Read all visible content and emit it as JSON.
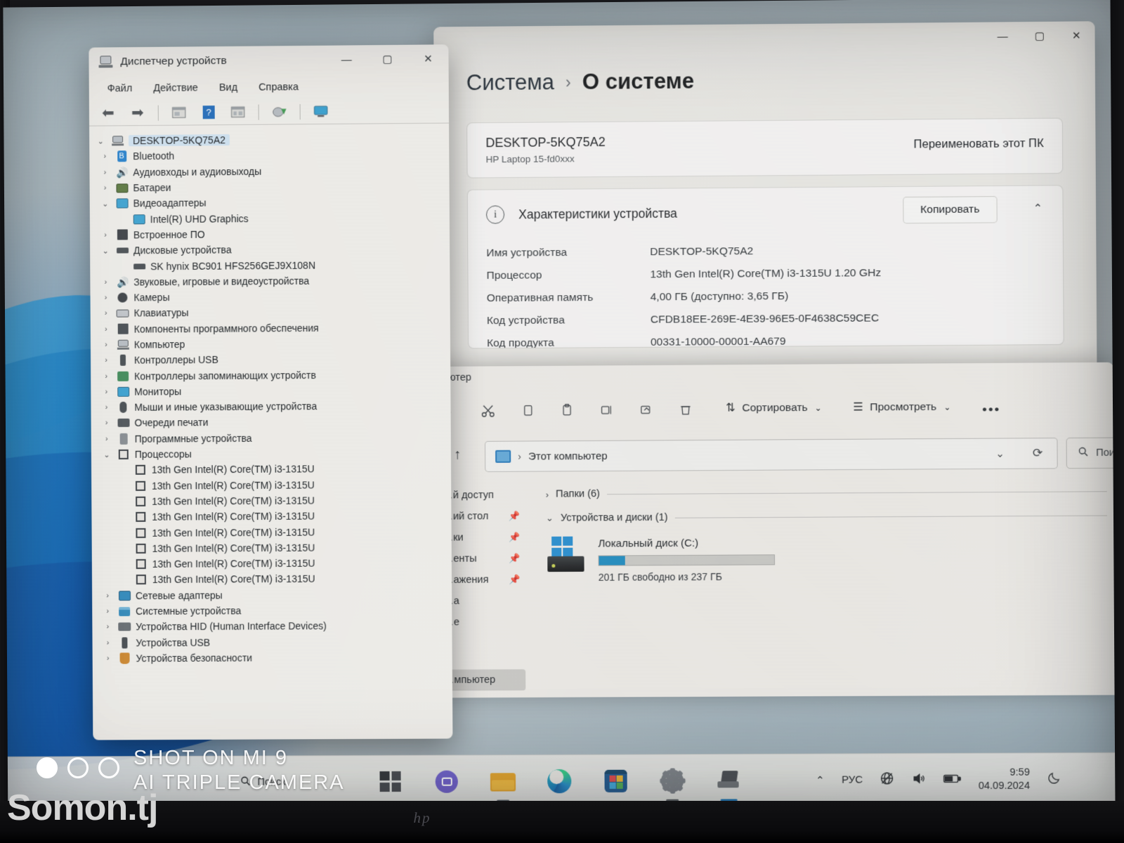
{
  "device_manager": {
    "title": "Диспетчер устройств",
    "window_controls": {
      "minimize": "—",
      "maximize": "▢",
      "close": "✕"
    },
    "menu": [
      "Файл",
      "Действие",
      "Вид",
      "Справка"
    ],
    "root": "DESKTOP-5KQ75A2",
    "tree": [
      {
        "label": "Bluetooth",
        "icon": "bluetooth-icon",
        "level": 1,
        "expanded": false
      },
      {
        "label": "Аудиовходы и аудиовыходы",
        "icon": "speaker-icon",
        "level": 1,
        "expanded": false
      },
      {
        "label": "Батареи",
        "icon": "battery-icon",
        "level": 1,
        "expanded": false
      },
      {
        "label": "Видеоадаптеры",
        "icon": "display-adapter-icon",
        "level": 1,
        "expanded": true
      },
      {
        "label": "Intel(R) UHD Graphics",
        "icon": "display-adapter-icon",
        "level": 2,
        "expanded": null
      },
      {
        "label": "Встроенное ПО",
        "icon": "firmware-icon",
        "level": 1,
        "expanded": false
      },
      {
        "label": "Дисковые устройства",
        "icon": "disk-icon",
        "level": 1,
        "expanded": true
      },
      {
        "label": "SK hynix BC901 HFS256GEJ9X108N",
        "icon": "disk-icon",
        "level": 2,
        "expanded": null
      },
      {
        "label": "Звуковые, игровые и видеоустройства",
        "icon": "speaker-icon",
        "level": 1,
        "expanded": false
      },
      {
        "label": "Камеры",
        "icon": "camera-icon",
        "level": 1,
        "expanded": false
      },
      {
        "label": "Клавиатуры",
        "icon": "keyboard-icon",
        "level": 1,
        "expanded": false
      },
      {
        "label": "Компоненты программного обеспечения",
        "icon": "software-component-icon",
        "level": 1,
        "expanded": false
      },
      {
        "label": "Компьютер",
        "icon": "computer-icon",
        "level": 1,
        "expanded": false
      },
      {
        "label": "Контроллеры USB",
        "icon": "usb-icon",
        "level": 1,
        "expanded": false
      },
      {
        "label": "Контроллеры запоминающих устройств",
        "icon": "storage-controller-icon",
        "level": 1,
        "expanded": false
      },
      {
        "label": "Мониторы",
        "icon": "monitor-icon",
        "level": 1,
        "expanded": false
      },
      {
        "label": "Мыши и иные указывающие устройства",
        "icon": "mouse-icon",
        "level": 1,
        "expanded": false
      },
      {
        "label": "Очереди печати",
        "icon": "printer-icon",
        "level": 1,
        "expanded": false
      },
      {
        "label": "Программные устройства",
        "icon": "software-device-icon",
        "level": 1,
        "expanded": false
      },
      {
        "label": "Процессоры",
        "icon": "cpu-icon",
        "level": 1,
        "expanded": true
      },
      {
        "label": "13th Gen Intel(R) Core(TM) i3-1315U",
        "icon": "cpu-icon",
        "level": 2,
        "expanded": null
      },
      {
        "label": "13th Gen Intel(R) Core(TM) i3-1315U",
        "icon": "cpu-icon",
        "level": 2,
        "expanded": null
      },
      {
        "label": "13th Gen Intel(R) Core(TM) i3-1315U",
        "icon": "cpu-icon",
        "level": 2,
        "expanded": null
      },
      {
        "label": "13th Gen Intel(R) Core(TM) i3-1315U",
        "icon": "cpu-icon",
        "level": 2,
        "expanded": null
      },
      {
        "label": "13th Gen Intel(R) Core(TM) i3-1315U",
        "icon": "cpu-icon",
        "level": 2,
        "expanded": null
      },
      {
        "label": "13th Gen Intel(R) Core(TM) i3-1315U",
        "icon": "cpu-icon",
        "level": 2,
        "expanded": null
      },
      {
        "label": "13th Gen Intel(R) Core(TM) i3-1315U",
        "icon": "cpu-icon",
        "level": 2,
        "expanded": null
      },
      {
        "label": "13th Gen Intel(R) Core(TM) i3-1315U",
        "icon": "cpu-icon",
        "level": 2,
        "expanded": null
      },
      {
        "label": "Сетевые адаптеры",
        "icon": "network-icon",
        "level": 1,
        "expanded": false
      },
      {
        "label": "Системные устройства",
        "icon": "system-device-icon",
        "level": 1,
        "expanded": false
      },
      {
        "label": "Устройства HID (Human Interface Devices)",
        "icon": "hid-icon",
        "level": 1,
        "expanded": false
      },
      {
        "label": "Устройства USB",
        "icon": "usb-icon",
        "level": 1,
        "expanded": false
      },
      {
        "label": "Устройства безопасности",
        "icon": "security-icon",
        "level": 1,
        "expanded": false
      }
    ]
  },
  "settings": {
    "window_controls": {
      "minimize": "—",
      "maximize": "▢",
      "close": "✕"
    },
    "breadcrumb_parent": "Система",
    "breadcrumb_separator": "›",
    "breadcrumb_current": "О системе",
    "pc_name": "DESKTOP-5KQ75A2",
    "pc_model": "HP Laptop 15-fd0xxx",
    "rename_button": "Переименовать этот ПК",
    "specs_title": "Характеристики устройства",
    "copy_button": "Копировать",
    "collapse_chevron": "⌃",
    "info_glyph": "i",
    "specs": [
      {
        "key": "Имя устройства",
        "value": "DESKTOP-5KQ75A2"
      },
      {
        "key": "Процессор",
        "value": "13th Gen Intel(R) Core(TM) i3-1315U   1.20 GHz"
      },
      {
        "key": "Оперативная память",
        "value": "4,00 ГБ (доступно: 3,65 ГБ)"
      },
      {
        "key": "Код устройства",
        "value": "CFDB18EE-269E-4E39-96E5-0F4638C59CEC"
      },
      {
        "key": "Код продукта",
        "value": "00331-10000-00001-AA679"
      }
    ]
  },
  "explorer": {
    "title_fragment": "…ютер",
    "toolbar_icons": [
      "cut-icon",
      "copy-icon",
      "paste-icon",
      "rename-icon",
      "share-icon",
      "delete-icon"
    ],
    "sort_button": "Сортировать",
    "view_button": "Просмотреть",
    "more_button": "•••",
    "up_arrow": "↑",
    "address_text": "Этот компьютер",
    "address_separator": "›",
    "address_chevron": "⌄",
    "refresh_icon": "refresh-icon",
    "search_placeholder": "Поиск",
    "nav_items": [
      {
        "label": "…й доступ",
        "pinned": false
      },
      {
        "label": "…ий стол",
        "pinned": true
      },
      {
        "label": "…ки",
        "pinned": true
      },
      {
        "label": "…енты",
        "pinned": true
      },
      {
        "label": "…ажения",
        "pinned": true
      },
      {
        "label": "…а",
        "pinned": false
      },
      {
        "label": "…е",
        "pinned": false
      }
    ],
    "selected_nav_item": "…мпьютер",
    "groups": [
      {
        "label": "Папки (6)",
        "expanded": false
      },
      {
        "label": "Устройства и диски (1)",
        "expanded": true
      }
    ],
    "drive": {
      "name": "Локальный диск (C:)",
      "free_text": "201 ГБ свободно из 237 ГБ",
      "used_percent": 15,
      "bar_color": "#1a8ec5"
    }
  },
  "taskbar": {
    "items": [
      {
        "name": "start-button",
        "icon": "start-icon",
        "active": false
      },
      {
        "name": "chat-button",
        "icon": "chat-icon",
        "active": false
      },
      {
        "name": "file-explorer-button",
        "icon": "folder-icon",
        "active": true
      },
      {
        "name": "edge-button",
        "icon": "edge-icon",
        "active": false
      },
      {
        "name": "microsoft-store-button",
        "icon": "store-icon",
        "active": false
      },
      {
        "name": "settings-button",
        "icon": "gear-icon",
        "active": true
      },
      {
        "name": "device-manager-button",
        "icon": "device-manager-icon",
        "active": true
      }
    ],
    "search_label": "Поиск",
    "tray": {
      "chevron": "⌃",
      "language": "РУС",
      "network_icon": "globe-icon",
      "volume_icon": "speaker-icon",
      "battery_icon": "battery-icon",
      "time": "9:59",
      "date": "04.09.2024",
      "notifications_icon": "moon-icon"
    }
  },
  "watermarks": {
    "shot_on": "SHOT ON MI 9",
    "camera": "AI TRIPLE CAMERA",
    "site": "Somon.tj"
  }
}
